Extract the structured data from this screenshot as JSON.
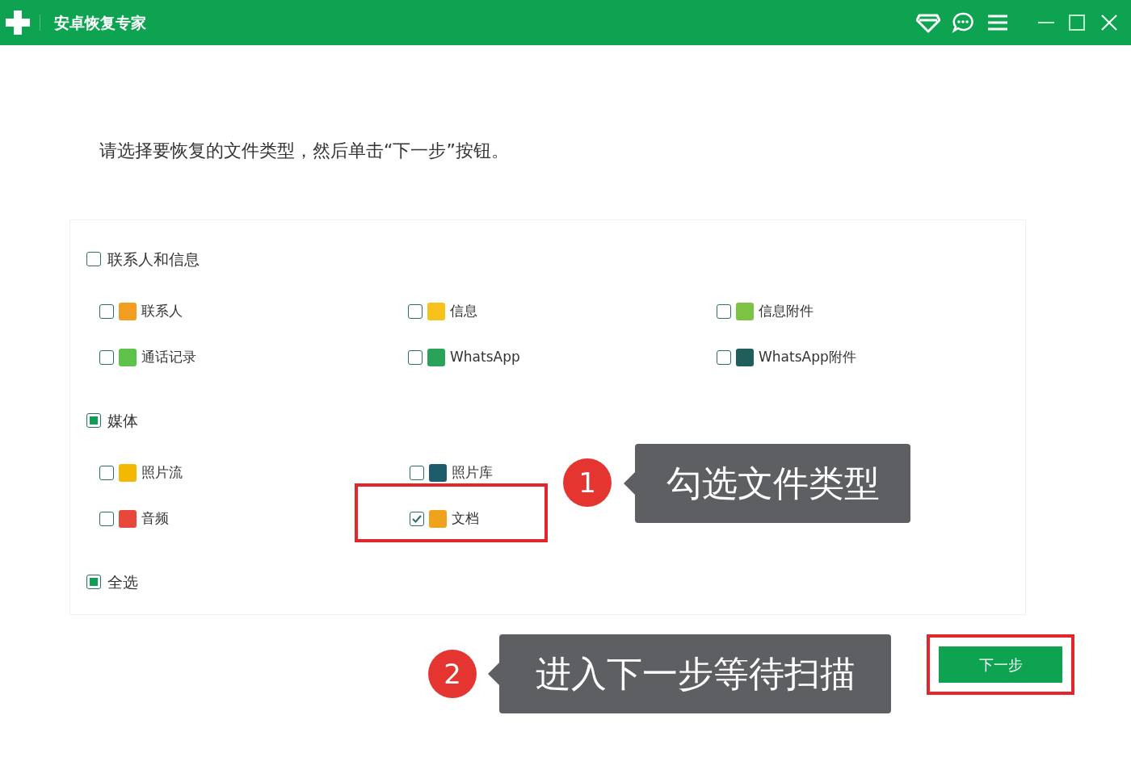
{
  "window": {
    "title": "安卓恢复专家"
  },
  "instruction": "请选择要恢复的文件类型，然后单击“下一步”按钮。",
  "groups": [
    {
      "label": "联系人和信息",
      "checked": false,
      "rows": [
        [
          {
            "label": "联系人",
            "checked": false,
            "color": "#f39c1f",
            "highlighted": false
          },
          {
            "label": "信息",
            "checked": false,
            "color": "#f7c21b",
            "highlighted": false
          },
          {
            "label": "信息附件",
            "checked": false,
            "color": "#7dc242",
            "highlighted": false
          }
        ],
        [
          {
            "label": "通话记录",
            "checked": false,
            "color": "#5cc24a",
            "highlighted": false
          },
          {
            "label": "WhatsApp",
            "checked": false,
            "color": "#2aa35a",
            "highlighted": false
          },
          {
            "label": "WhatsApp附件",
            "checked": false,
            "color": "#1f5e5a",
            "highlighted": false
          }
        ]
      ]
    },
    {
      "label": "媒体",
      "checked": true,
      "rows": [
        [
          {
            "label": "照片流",
            "checked": false,
            "color": "#f5b800",
            "highlighted": false
          },
          {
            "label": "照片库",
            "checked": false,
            "color": "#1d5d6b",
            "highlighted": false
          }
        ],
        [
          {
            "label": "音频",
            "checked": false,
            "color": "#e8483b",
            "highlighted": false
          },
          {
            "label": "文档",
            "checked": true,
            "color": "#f0a21c",
            "highlighted": true
          }
        ]
      ]
    },
    {
      "label": "全选",
      "checked": true
    }
  ],
  "next_button": {
    "label": "下一步",
    "highlighted": true
  },
  "annotations": [
    {
      "number": "1",
      "text": "勾选文件类型"
    },
    {
      "number": "2",
      "text": "进入下一步等待扫描"
    }
  ]
}
